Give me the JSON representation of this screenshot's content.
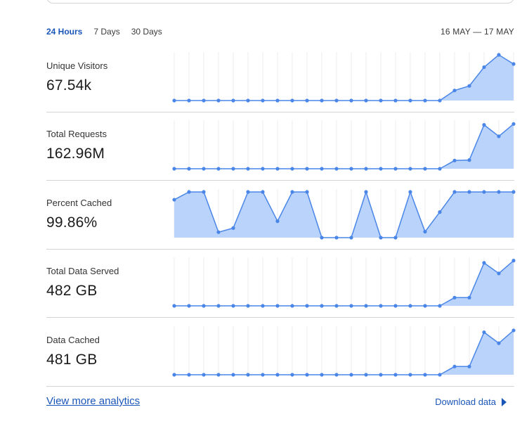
{
  "tabs": [
    {
      "label": "24 Hours",
      "active": true
    },
    {
      "label": "7 Days",
      "active": false
    },
    {
      "label": "30 Days",
      "active": false
    }
  ],
  "date_range": "16 MAY — 17 MAY",
  "colors": {
    "accent": "#1a56b8",
    "line": "#4a86e8",
    "fill": "#b9d3fb"
  },
  "metrics": [
    {
      "label": "Unique Visitors",
      "value": "67.54k",
      "series": [
        0,
        0,
        0,
        0,
        0,
        0,
        0,
        0,
        0,
        0,
        0,
        0,
        0,
        0,
        0,
        0,
        0,
        0,
        0,
        0.22,
        0.32,
        0.73,
        1,
        0.8
      ]
    },
    {
      "label": "Total Requests",
      "value": "162.96M",
      "series": [
        0,
        0,
        0,
        0,
        0,
        0,
        0,
        0,
        0,
        0,
        0,
        0,
        0,
        0,
        0,
        0,
        0,
        0,
        0,
        0.18,
        0.19,
        0.96,
        0.71,
        0.98
      ]
    },
    {
      "label": "Percent Cached",
      "value": "99.86%",
      "series": [
        0.83,
        1,
        1,
        0.12,
        0.21,
        1,
        1,
        0.36,
        1,
        1,
        0,
        0,
        0,
        1,
        0,
        0,
        1,
        0.13,
        0.56,
        1,
        1,
        1,
        1,
        1
      ]
    },
    {
      "label": "Total Data Served",
      "value": "482 GB",
      "series": [
        0,
        0,
        0,
        0,
        0,
        0,
        0,
        0,
        0,
        0,
        0,
        0,
        0,
        0,
        0,
        0,
        0,
        0,
        0,
        0.18,
        0.18,
        0.94,
        0.71,
        0.99
      ]
    },
    {
      "label": "Data Cached",
      "value": "481 GB",
      "series": [
        0,
        0,
        0,
        0,
        0,
        0,
        0,
        0,
        0,
        0,
        0,
        0,
        0,
        0,
        0,
        0,
        0,
        0,
        0,
        0.18,
        0.18,
        0.93,
        0.69,
        0.97
      ]
    }
  ],
  "footer": {
    "view_more": "View more analytics",
    "download": "Download data"
  }
}
